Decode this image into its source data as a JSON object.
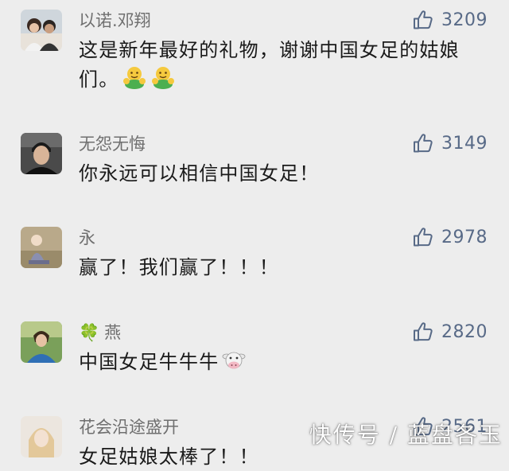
{
  "comments": [
    {
      "username": "以诺.邓翔",
      "likes": "3209",
      "text": "这是新年最好的礼物，谢谢中国女足的姑娘们。"
    },
    {
      "username": "无怨无悔",
      "likes": "3149",
      "text": "你永远可以相信中国女足！"
    },
    {
      "username": "永",
      "likes": "2978",
      "text": "赢了！我们赢了！！！"
    },
    {
      "username": "燕",
      "username_prefix_icon": "four-leaf-clover",
      "likes": "2820",
      "text": "中国女足牛牛牛"
    },
    {
      "username": "花会沿途盛开",
      "likes": "2561",
      "text": "女足姑娘太棒了！！"
    }
  ],
  "emojis": {
    "c0": [
      "hug-emoji",
      "hug-emoji"
    ],
    "c3": [
      "cow-emoji"
    ]
  },
  "watermark": "快传号 / 蓝盘各玉",
  "colors": {
    "background": "#ededed",
    "username": "#6f6f6f",
    "like_count": "#586a87",
    "text": "#1a1a1a"
  }
}
